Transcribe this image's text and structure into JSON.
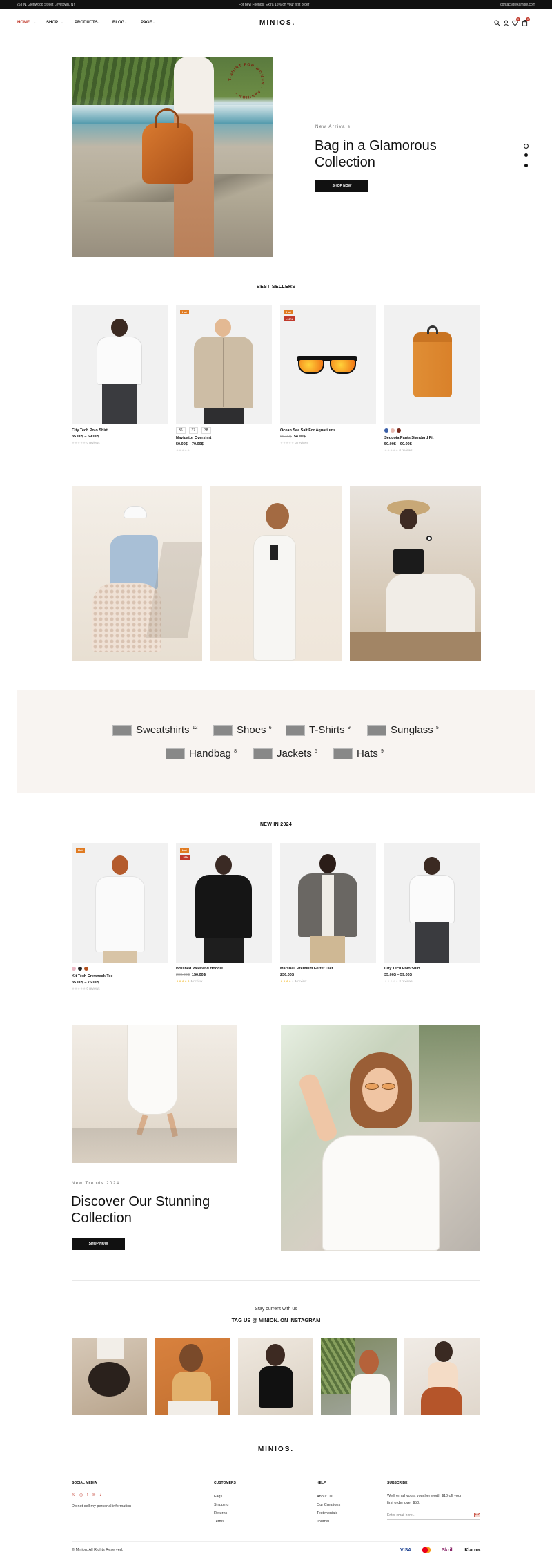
{
  "topbar": {
    "address": "263 N. Glenwood Street Levittown, NY",
    "promo": "For new Friends: Extra 15% off your first order",
    "email": "contact@example.com"
  },
  "nav": {
    "items": [
      {
        "label": "HOME",
        "active": true
      },
      {
        "label": "SHOP"
      },
      {
        "label": "PRODUCTS"
      },
      {
        "label": "BLOG"
      },
      {
        "label": "PAGE"
      }
    ],
    "logo": "MINIOS.",
    "wishlist_count": "0",
    "cart_count": "0",
    "icons": [
      "search-icon",
      "user-icon",
      "heart-icon",
      "bag-icon"
    ]
  },
  "hero": {
    "eyebrow": "New Arrivals",
    "title_line1": "Bag in a Glamorous",
    "title_line2": "Collection",
    "button": "SHOP NOW",
    "stamp_text": "T-SHIRT FOR WOMEN · FASHION ·"
  },
  "best_sellers": {
    "title": "BEST SELLERS",
    "products": [
      {
        "name": "City Tech Polo Shirt",
        "price": "35.00$ – 59.00$",
        "old_price": "",
        "reviews": "0 reviews",
        "stars": 0,
        "tag": "",
        "sale": ""
      },
      {
        "name": "Navigator Overshirt",
        "price": "50.00$ – 70.00$",
        "old_price": "",
        "reviews": "",
        "stars": 0,
        "tag": "Hot",
        "sale": "",
        "sizes": [
          "36",
          "37",
          "38"
        ]
      },
      {
        "name": "Ocean Sea Salt For Aquariums",
        "price": "54.00$",
        "old_price": "66.00$",
        "reviews": "0 reviews",
        "stars": 0,
        "tag": "Hot",
        "sale": "-10%"
      },
      {
        "name": "Sequoia Pants Standard Fit",
        "price": "50.00$ – 90.00$",
        "old_price": "",
        "reviews": "0 reviews",
        "stars": 0,
        "tag": "",
        "sale": "",
        "swatches": [
          "#3a5fa8",
          "#e7b9b0",
          "#7a2a1d"
        ]
      }
    ]
  },
  "categories": [
    {
      "name": "Sweatshirts",
      "count": "12"
    },
    {
      "name": "Shoes",
      "count": "6"
    },
    {
      "name": "T-Shirts",
      "count": "9"
    },
    {
      "name": "Sunglass",
      "count": "5"
    },
    {
      "name": "Handbag",
      "count": "8"
    },
    {
      "name": "Jackets",
      "count": "5"
    },
    {
      "name": "Hats",
      "count": "9"
    }
  ],
  "new_in": {
    "title": "NEW IN 2024",
    "products": [
      {
        "name": "Kit Tech Crewneck Tee",
        "price": "35.00$ – 76.00$",
        "old_price": "",
        "reviews": "0 reviews",
        "tag": "Hot",
        "sale": "",
        "swatches": [
          "#e9b7c3",
          "#222222",
          "#b4521f"
        ]
      },
      {
        "name": "Brushed Weekend Hoodie",
        "price": "150.00$",
        "old_price": "200.00$",
        "reviews": "1 review",
        "stars": 5,
        "tag": "Hot",
        "sale": "-25%"
      },
      {
        "name": "Marshall Premium Ferret Diet",
        "price": "236.00$",
        "old_price": "",
        "reviews": "1 review",
        "stars": 4,
        "tag": "",
        "sale": ""
      },
      {
        "name": "City Tech Polo Shirt",
        "price": "35.00$ – 59.00$",
        "old_price": "",
        "reviews": "0 reviews",
        "tag": "",
        "sale": ""
      }
    ]
  },
  "promo": {
    "eyebrow": "New Trends 2024",
    "title_line1": "Discover Our Stunning",
    "title_line2": "Collection",
    "button": "SHOP NOW"
  },
  "instagram": {
    "subtitle": "Stay current with us",
    "title": "TAG US @ MINION. ON INSTAGRAM"
  },
  "footer": {
    "logo": "MINIOS.",
    "social": {
      "heading": "SOCIAL MEDIA",
      "note": "Do not sell my personal information",
      "icons": [
        "x-icon",
        "instagram-icon",
        "facebook-icon",
        "pinterest-icon",
        "tiktok-icon"
      ]
    },
    "customers": {
      "heading": "CUSTOMERS",
      "links": [
        "Faqs",
        "Shipping",
        "Returns",
        "Terms"
      ]
    },
    "help": {
      "heading": "HELP",
      "links": [
        "About Us",
        "Our Creations",
        "Testimonials",
        "Journal"
      ]
    },
    "subscribe": {
      "heading": "SUBSCRIBE",
      "text_line1": "We'll email you a voucher worth $10 off your",
      "text_line2": "first order over $50.",
      "placeholder": "Enter email here..."
    },
    "copyright": "© Minion. All Rights Reserved.",
    "payments": [
      "VISA",
      "mastercard",
      "Skrill",
      "Klarna."
    ]
  },
  "colors": {
    "accent": "#c0392b",
    "tag_hot": "#e07b22",
    "tag_sale": "#c0392b",
    "category_bg": "#f8f4f1"
  }
}
